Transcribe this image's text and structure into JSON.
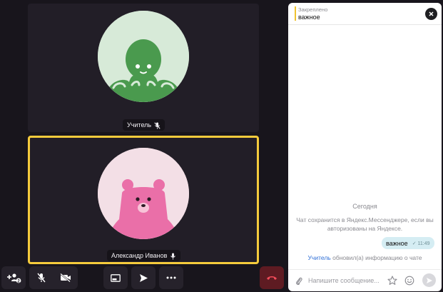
{
  "participants": [
    {
      "name": "Учитель",
      "mic_muted": true,
      "avatar_icon": "octopus-avatar-icon",
      "avatar_bg": "#d7ead8",
      "avatar_color": "#4a9a4e"
    },
    {
      "name": "Александр Иванов",
      "mic_muted": false,
      "active_speaker": true,
      "avatar_icon": "bear-avatar-icon",
      "avatar_bg": "#f3dfe6",
      "avatar_color": "#ea6fa8"
    }
  ],
  "toolbar": {
    "invite_count": "2",
    "icons": [
      "add-participant-icon",
      "mic-off-icon",
      "camera-off-icon",
      "screen-share-icon",
      "send-icon",
      "more-icon",
      "hang-up-icon"
    ]
  },
  "chat": {
    "pinned": {
      "title": "Закреплено",
      "text": "важное"
    },
    "day_label": "Сегодня",
    "save_note": "Чат сохранится в Яндекс.Мессенджере, если вы авторизованы на Яндексе.",
    "message": {
      "text": "важное",
      "time": "✓ 11:49"
    },
    "system_note": {
      "who": "Учитель",
      "rest": " обновил(а) информацию о чате"
    },
    "composer": {
      "placeholder": "Напишите сообщение..."
    }
  },
  "colors": {
    "active_border": "#f5cb3c",
    "hangup": "#5e1b22",
    "bubble": "#d5edf3",
    "link": "#2f6fd6"
  }
}
